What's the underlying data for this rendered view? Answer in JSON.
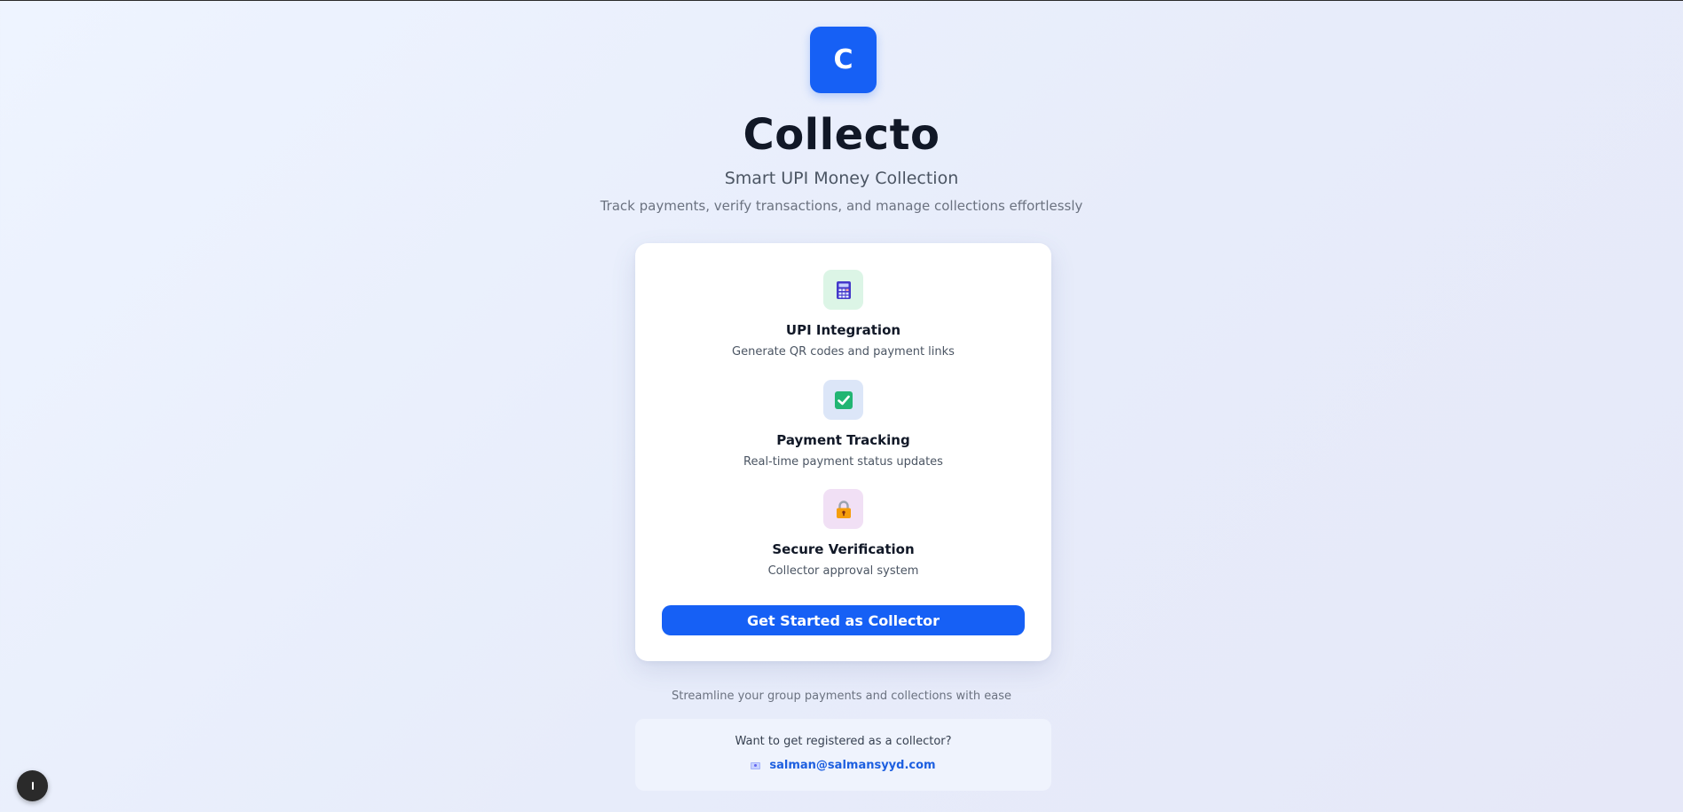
{
  "brand": {
    "logo_letter": "C",
    "title": "Collecto",
    "subtitle": "Smart UPI Money Collection",
    "tagline": "Track payments, verify transactions, and manage collections effortlessly",
    "accent_color": "#1660f5"
  },
  "features": [
    {
      "icon": "calculator-icon",
      "title": "UPI Integration",
      "description": "Generate QR codes and payment links"
    },
    {
      "icon": "check-box-icon",
      "title": "Payment Tracking",
      "description": "Real-time payment status updates"
    },
    {
      "icon": "lock-icon",
      "title": "Secure Verification",
      "description": "Collector approval system"
    }
  ],
  "cta": {
    "label": "Get Started as Collector"
  },
  "footer": {
    "text": "Streamline your group payments and collections with ease"
  },
  "register": {
    "question": "Want to get registered as a collector?",
    "email_icon": "email-icon",
    "email": "salman@salmansyyd.com"
  },
  "floating_button": {
    "icon": "info-icon"
  }
}
